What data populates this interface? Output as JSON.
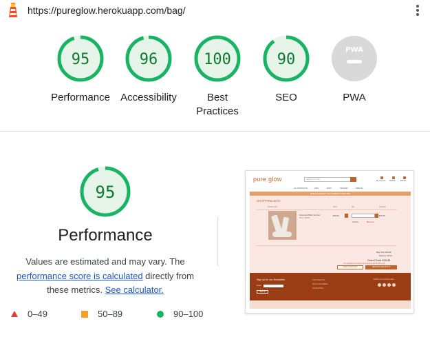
{
  "topbar": {
    "url": "https://pureglow.herokuapp.com/bag/",
    "logo_icon": "lighthouse-icon",
    "menu_icon": "kebab-menu-icon"
  },
  "categories": [
    {
      "score": "95",
      "label": "Performance",
      "value": 95
    },
    {
      "score": "96",
      "label": "Accessibility",
      "value": 96
    },
    {
      "score": "100",
      "label": "Best Practices",
      "value": 100
    },
    {
      "score": "90",
      "label": "SEO",
      "value": 90
    },
    {
      "score": "",
      "label": "PWA",
      "value": null,
      "badge": "PWA"
    }
  ],
  "performance": {
    "score": "95",
    "value": 95,
    "title": "Performance",
    "desc_1": "Values are estimated and may vary. The",
    "desc_link_1": "performance score is calculated",
    "desc_2": "directly from these metrics.",
    "desc_link_2": "See calculator."
  },
  "legend": [
    {
      "range": "0–49",
      "shape": "triangle",
      "color": "#e53935"
    },
    {
      "range": "50–89",
      "shape": "square",
      "color": "#f4a027"
    },
    {
      "range": "90–100",
      "shape": "circle",
      "color": "#18b463"
    }
  ],
  "colors": {
    "pass": "#18b463",
    "pass_text": "#0c7a2e",
    "pass_fill": "#e6f4ea",
    "gray": "#d9d9d9",
    "brand": "#c0622a"
  },
  "screenshot": {
    "brand": "pure glow",
    "search_placeholder": "Search our site",
    "icons": [
      "My Account",
      "Wishlist",
      "€26.95"
    ],
    "nav": [
      "ALL PRODUCTS",
      "SKIN",
      "BODY",
      "ORGANIC",
      "SPECIAL"
    ],
    "banner": "FREE DELIVERY ON ORDERS OVER €50!",
    "bag_title": "SHOPPING BAG",
    "headers": [
      "Product Info",
      "Price",
      "Qty",
      "Subtotal"
    ],
    "product_name": "Gloss and Balm Set duo",
    "product_sku": "SKU: 10394",
    "price": "€26.95",
    "subtotal": "€26.95",
    "update": "Update",
    "remove": "Remove",
    "bag_total": "Bag Total: €26.95",
    "delivery": "Delivery: €0.00",
    "grand_total": "Grand Total: €26.95",
    "free_delivery_note": "You could get free delivery by spending just €23.05 more!",
    "keep_shopping": "KEEP SHOPPING",
    "secure_checkout": "SECURE CHECKOUT",
    "newsletter": "Sign up for our Newsletter",
    "email_label": "Email",
    "signup": "Sign Up",
    "footer_links": [
      "Learn About Us",
      "Terms & Conditions",
      "Privacy Policy"
    ],
    "social_title": "Follow us on social media"
  }
}
